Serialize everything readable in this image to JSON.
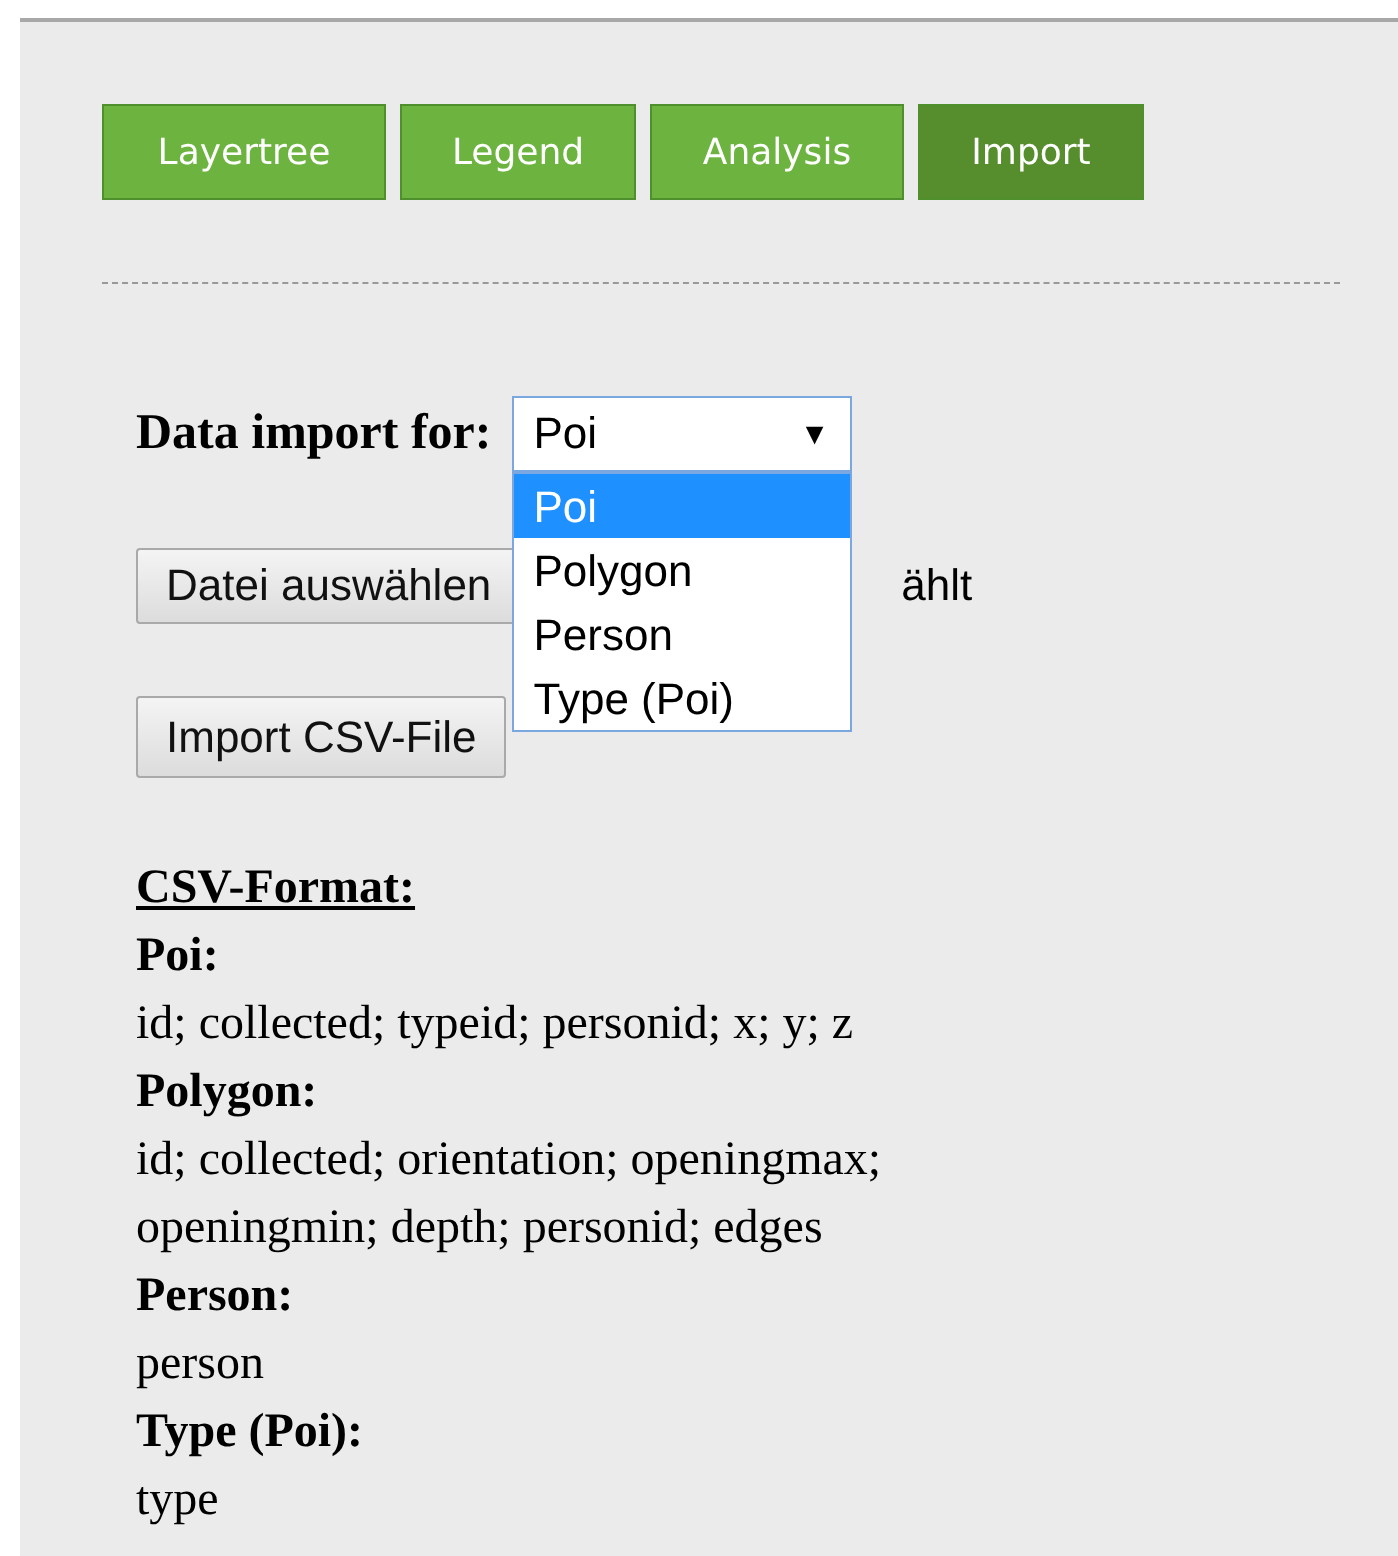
{
  "tabs": [
    {
      "label": "Layertree",
      "selected": false
    },
    {
      "label": "Legend",
      "selected": false
    },
    {
      "label": "Analysis",
      "selected": false
    },
    {
      "label": "Import",
      "selected": true
    }
  ],
  "import_form": {
    "label": "Data import for:",
    "select": {
      "value": "Poi",
      "arrow": "▼",
      "expanded": true,
      "options": [
        {
          "label": "Poi",
          "selected": true
        },
        {
          "label": "Polygon",
          "selected": false
        },
        {
          "label": "Person",
          "selected": false
        },
        {
          "label": "Type (Poi)",
          "selected": false
        }
      ]
    },
    "file_button": "Datei auswählen",
    "file_status": "ählt",
    "import_button": "Import CSV-File"
  },
  "csv_format": {
    "title": "CSV-Format:",
    "sections": [
      {
        "heading": "Poi:",
        "text": "id; collected; typeid; personid; x; y; z"
      },
      {
        "heading": "Polygon:",
        "text": "id; collected; orientation; openingmax; openingmin; depth; personid; edges"
      },
      {
        "heading": "Person:",
        "text": "person"
      },
      {
        "heading": "Type (Poi):",
        "text": "type"
      }
    ]
  }
}
